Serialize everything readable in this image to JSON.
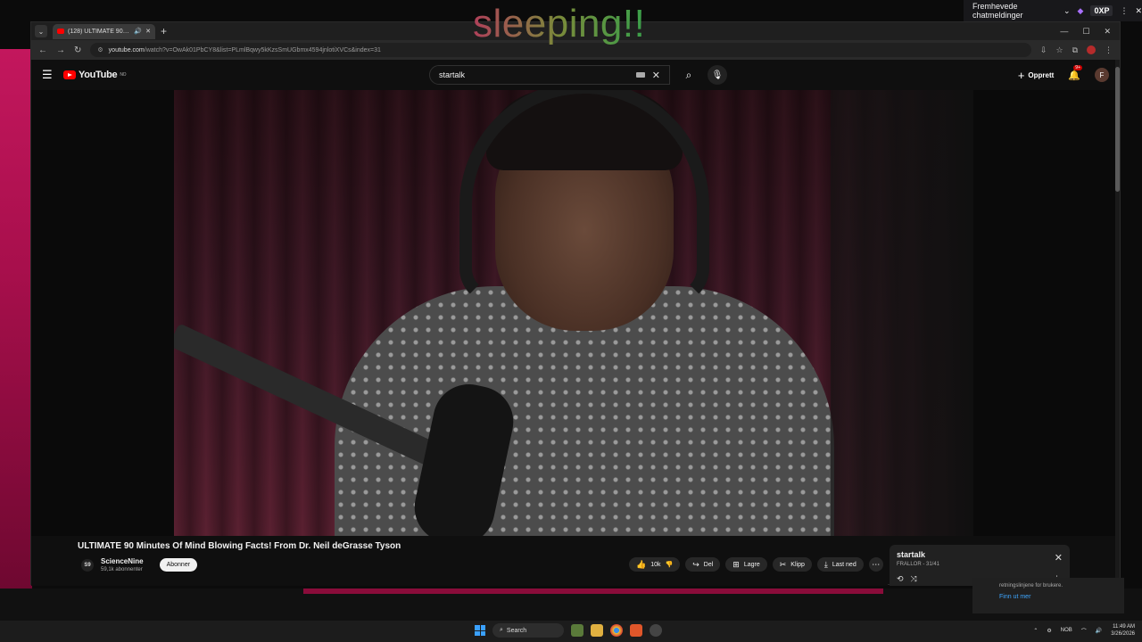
{
  "overlay": {
    "title": "sleeping!!",
    "chat_label": "Fremhevede chatmeldinger",
    "xp": "0XP"
  },
  "browser": {
    "tab_title": "(128) ULTIMATE 90 Minute...",
    "url_host": "youtube.com",
    "url_path": "/watch?v=OwAk01PbCY8&list=PLmlBqwy5kKzsSmUGbmx4594jnlotiXVCs&index=31",
    "controls": {
      "minimize": "—",
      "maximize": "☐",
      "close": "✕"
    }
  },
  "youtube": {
    "logo_text": "YouTube",
    "logo_region": "NO",
    "search_value": "startalk",
    "create_label": "Opprett",
    "notifications_badge": "9+",
    "avatar_letter": "F"
  },
  "video": {
    "title": "ULTIMATE 90 Minutes Of Mind Blowing Facts! From Dr. Neil deGrasse Tyson",
    "channel_name": "ScienceNine",
    "channel_initials": "S9",
    "subscribers": "59,1k abonnenter",
    "subscribe_label": "Abonner",
    "likes": "10k",
    "share_label": "Del",
    "save_label": "Lagre",
    "clip_label": "Klipp",
    "download_label": "Last ned"
  },
  "playlist": {
    "title": "startalk",
    "subtitle": "FRALLOR - 31/41"
  },
  "peek": {
    "text": "retningslinjene for brukere.",
    "link": "Finn ut mer"
  },
  "taskbar": {
    "search_label": "Search",
    "lang": "NOB",
    "time": "11:49 AM",
    "date": "3/26/2026"
  }
}
